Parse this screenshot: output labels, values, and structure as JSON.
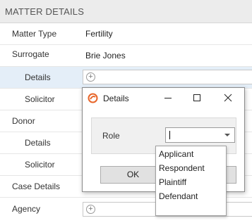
{
  "section": {
    "title": "MATTER DETAILS"
  },
  "rows": [
    {
      "label": "Matter Type",
      "value": "Fertility"
    },
    {
      "label": "Surrogate",
      "value": "Brie Jones"
    },
    {
      "label": "Details",
      "value": ""
    },
    {
      "label": "Solicitor",
      "value": ""
    },
    {
      "label": "Donor",
      "value": ""
    },
    {
      "label": "Details",
      "value": ""
    },
    {
      "label": "Solicitor",
      "value": ""
    },
    {
      "label": "Case Details",
      "value": ""
    },
    {
      "label": "Agency",
      "value": ""
    }
  ],
  "dialog": {
    "title": "Details",
    "role_label": "Role",
    "role_value": "",
    "ok_label": "OK",
    "role_options": [
      "Applicant",
      "Respondent",
      "Plaintiff",
      "Defendant"
    ]
  },
  "icons": {
    "app_logo": "app-logo-icon",
    "minimize": "minimize-icon",
    "maximize": "maximize-icon",
    "close": "close-icon",
    "add": "plus-circle-icon",
    "dropdown": "chevron-down-icon"
  },
  "colors": {
    "selected_row": "#e4eef8",
    "header_bg": "#ececec",
    "logo": "#e8662a"
  }
}
